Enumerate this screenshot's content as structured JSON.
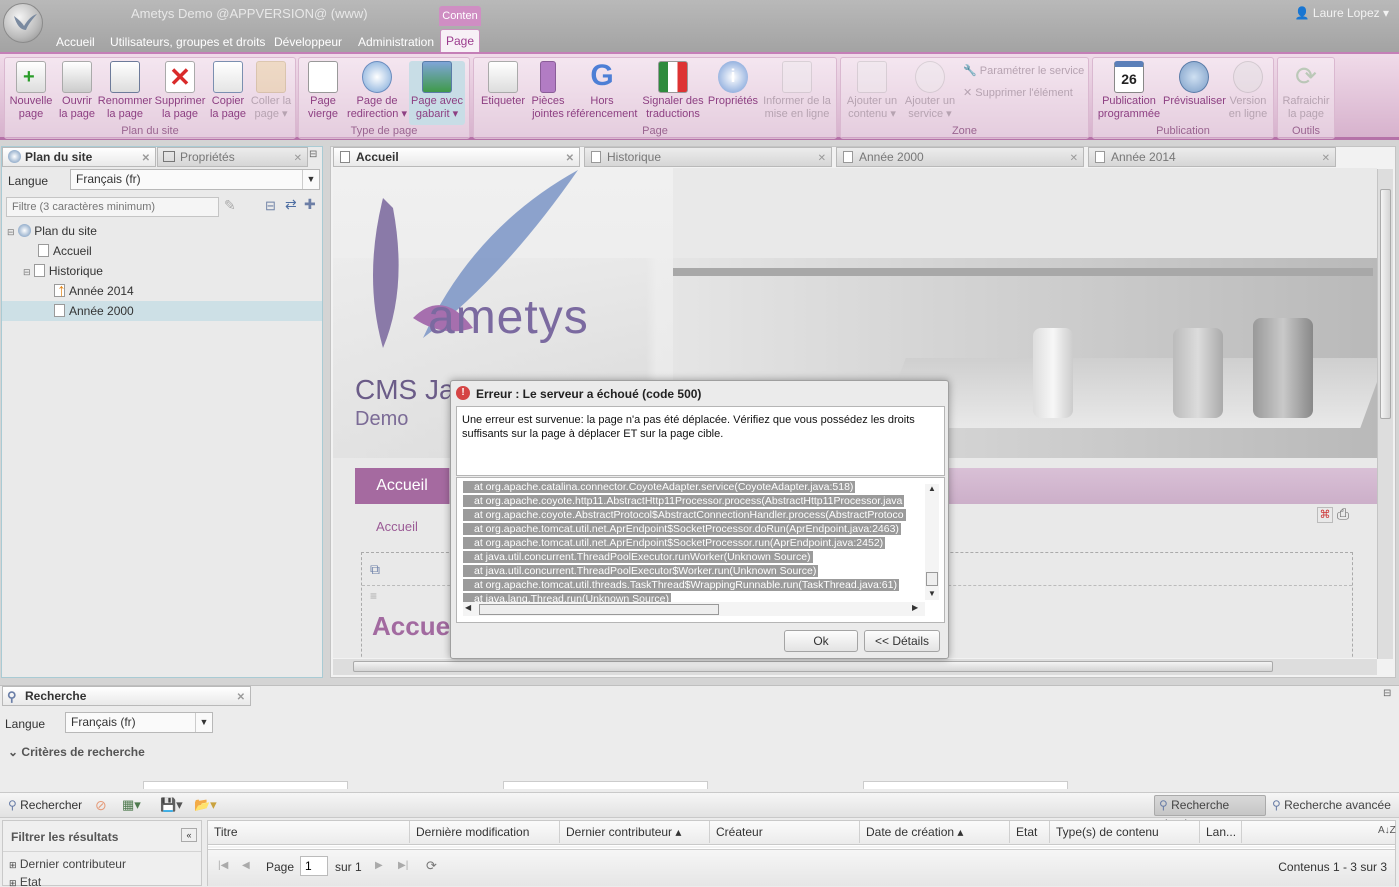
{
  "titlebar": {
    "app_title": "Ametys Demo @APPVERSION@ (www)",
    "context_tab": "Conten",
    "user_name": "Laure Lopez ▾"
  },
  "menu": {
    "tabs": [
      "Accueil",
      "Utilisateurs, groupes et droits",
      "Développeur",
      "Administration",
      "Page"
    ],
    "active": "Page"
  },
  "ribbon": {
    "groups": [
      {
        "label": "Plan du site",
        "buttons": [
          {
            "label": "Nouvelle page",
            "icon": "new-page-icon",
            "enabled": true
          },
          {
            "label": "Ouvrir la page",
            "icon": "open-page-icon",
            "enabled": true
          },
          {
            "label": "Renommer la page",
            "icon": "rename-icon",
            "enabled": true
          },
          {
            "label": "Supprimer la page",
            "icon": "delete-icon",
            "enabled": true
          },
          {
            "label": "Copier la page",
            "icon": "copy-icon",
            "enabled": true
          },
          {
            "label": "Coller la page ▾",
            "icon": "paste-icon",
            "enabled": false
          }
        ]
      },
      {
        "label": "Type de page",
        "buttons": [
          {
            "label": "Page vierge",
            "icon": "blank-page-icon",
            "enabled": true
          },
          {
            "label": "Page de redirection ▾",
            "icon": "redirect-icon",
            "enabled": true
          },
          {
            "label": "Page avec gabarit ▾",
            "icon": "template-icon",
            "enabled": true
          }
        ]
      },
      {
        "label": "Page",
        "buttons": [
          {
            "label": "Etiqueter",
            "icon": "tag-icon",
            "enabled": true
          },
          {
            "label": "Pièces jointes",
            "icon": "attachment-icon",
            "enabled": true
          },
          {
            "label": "Hors référencement",
            "icon": "google-icon",
            "enabled": true
          },
          {
            "label": "Signaler des traductions",
            "icon": "flags-icon",
            "enabled": true
          },
          {
            "label": "Propriétés",
            "icon": "info-icon",
            "enabled": true
          },
          {
            "label": "Informer de la mise en ligne",
            "icon": "mail-icon",
            "enabled": false
          }
        ]
      },
      {
        "label": "Zone",
        "buttons": [
          {
            "label": "Ajouter un contenu ▾",
            "icon": "add-content-icon",
            "enabled": false
          },
          {
            "label": "Ajouter un service ▾",
            "icon": "add-service-icon",
            "enabled": false
          }
        ],
        "small_buttons": [
          "Paramétrer le service",
          "Supprimer l'élément"
        ]
      },
      {
        "label": "Publication",
        "buttons": [
          {
            "label": "Publication programmée",
            "icon": "calendar-icon",
            "enabled": true
          },
          {
            "label": "Prévisualiser",
            "icon": "preview-icon",
            "enabled": true
          },
          {
            "label": "Version en ligne",
            "icon": "live-icon",
            "enabled": false
          }
        ],
        "calendar_day": "26"
      },
      {
        "label": "Outils",
        "buttons": [
          {
            "label": "Rafraichir la page",
            "icon": "refresh-icon",
            "enabled": false
          }
        ]
      }
    ]
  },
  "left": {
    "tabs": [
      "Plan du site",
      "Propriétés"
    ],
    "lang_label": "Langue",
    "lang_value": "Français (fr)",
    "filter_placeholder": "Filtre (3 caractères minimum)",
    "tree": [
      "Plan du site",
      "Accueil",
      "Historique",
      "Année 2014",
      "Année 2000"
    ],
    "selected": "Année 2000"
  },
  "center": {
    "tabs": [
      "Accueil",
      "Historique",
      "Année 2000",
      "Année 2014"
    ],
    "site": {
      "logo_text": "ametys",
      "headline": "CMS Ja",
      "subline": "Demo",
      "nav_active": "Accueil",
      "breadcrumb": "Accueil",
      "page_title": "Accueil"
    }
  },
  "dialog": {
    "title": "Erreur : Le serveur a échoué (code 500)",
    "message": "Une erreur est survenue: la page n'a pas été déplacée. Vérifiez que vous possédez les droits suffisants sur la page à déplacer ET sur la page cible.",
    "trace": [
      "at org.apache.catalina.connector.CoyoteAdapter.service(CoyoteAdapter.java:518)",
      "at org.apache.coyote.http11.AbstractHttp11Processor.process(AbstractHttp11Processor.java",
      "at org.apache.coyote.AbstractProtocol$AbstractConnectionHandler.process(AbstractProtoco",
      "at org.apache.tomcat.util.net.AprEndpoint$SocketProcessor.doRun(AprEndpoint.java:2463)",
      "at org.apache.tomcat.util.net.AprEndpoint$SocketProcessor.run(AprEndpoint.java:2452)",
      "at java.util.concurrent.ThreadPoolExecutor.runWorker(Unknown Source)",
      "at java.util.concurrent.ThreadPoolExecutor$Worker.run(Unknown Source)",
      "at org.apache.tomcat.util.threads.TaskThread$WrappingRunnable.run(TaskThread.java:61)",
      "at java.lang.Thread.run(Unknown Source)"
    ],
    "ok": "Ok",
    "details": "<< Détails"
  },
  "search": {
    "title": "Recherche",
    "lang_label": "Langue",
    "lang_value": "Français (fr)",
    "criteria": "Critères de recherche",
    "search_btn": "Rechercher",
    "simple": "Recherche simple",
    "advanced": "Recherche avancée",
    "filter_title": "Filtrer les résultats",
    "filters": [
      "Dernier contributeur",
      "Etat"
    ],
    "columns": [
      "Titre",
      "Dernière modification",
      "Dernier contributeur ▴",
      "Créateur",
      "Date de création ▴",
      "Etat",
      "Type(s) de contenu",
      "Lan..."
    ],
    "pager": {
      "page_label": "Page",
      "page": "1",
      "of": "sur 1",
      "summary": "Contenus 1 - 3 sur 3"
    }
  }
}
